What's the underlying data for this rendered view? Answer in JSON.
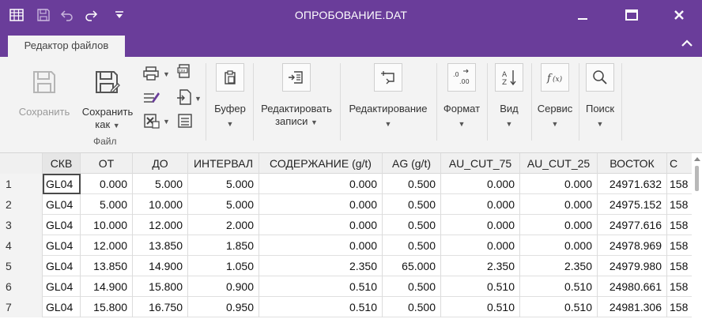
{
  "window": {
    "title": "ОПРОБОВАНИЕ.DAT",
    "accent": "#6a3d9a"
  },
  "quick_access": [
    "grid-icon",
    "save-icon",
    "undo-icon",
    "redo-icon",
    "customize-icon"
  ],
  "tab": {
    "label": "Редактор файлов"
  },
  "ribbon": {
    "save": {
      "label": "Сохранить"
    },
    "save_as": {
      "line1": "Сохранить",
      "line2": "как"
    },
    "file_group": "Файл",
    "buffer": {
      "label": "Буфер"
    },
    "edit_records": {
      "line1": "Редактировать",
      "line2": "записи"
    },
    "editing": {
      "label": "Редактирование"
    },
    "format": {
      "label": "Формат"
    },
    "view": {
      "label": "Вид"
    },
    "service": {
      "label": "Сервис"
    },
    "search": {
      "label": "Поиск"
    }
  },
  "grid": {
    "columns": [
      "СКВ",
      "ОТ",
      "ДО",
      "ИНТЕРВАЛ",
      "СОДЕРЖАНИЕ (g/t)",
      "AG (g/t)",
      "AU_CUT_75",
      "AU_CUT_25",
      "ВОСТОК",
      "С"
    ],
    "rows": [
      [
        "1",
        "GL04",
        "0.000",
        "5.000",
        "5.000",
        "0.000",
        "0.500",
        "0.000",
        "0.000",
        "24971.632",
        "158"
      ],
      [
        "2",
        "GL04",
        "5.000",
        "10.000",
        "5.000",
        "0.000",
        "0.500",
        "0.000",
        "0.000",
        "24975.152",
        "158"
      ],
      [
        "3",
        "GL04",
        "10.000",
        "12.000",
        "2.000",
        "0.000",
        "0.500",
        "0.000",
        "0.000",
        "24977.616",
        "158"
      ],
      [
        "4",
        "GL04",
        "12.000",
        "13.850",
        "1.850",
        "0.000",
        "0.500",
        "0.000",
        "0.000",
        "24978.969",
        "158"
      ],
      [
        "5",
        "GL04",
        "13.850",
        "14.900",
        "1.050",
        "2.350",
        "65.000",
        "2.350",
        "2.350",
        "24979.980",
        "158"
      ],
      [
        "6",
        "GL04",
        "14.900",
        "15.800",
        "0.900",
        "0.510",
        "0.500",
        "0.510",
        "0.510",
        "24980.661",
        "158"
      ],
      [
        "7",
        "GL04",
        "15.800",
        "16.750",
        "0.950",
        "0.510",
        "0.500",
        "0.510",
        "0.510",
        "24981.306",
        "158"
      ]
    ]
  }
}
